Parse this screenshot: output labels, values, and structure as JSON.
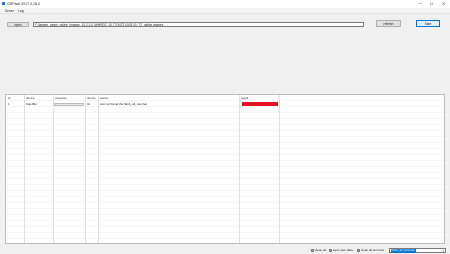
{
  "window": {
    "title": "GSPack 2017.4.28.0",
    "minimize_glyph": "—",
    "maximize_glyph": "☐",
    "close_glyph": "✕"
  },
  "menu": {
    "items": [
      "Driver",
      "Log"
    ]
  },
  "toolbar": {
    "open_label": "open",
    "path_value": "F:\\fastem_gesm_gslive_images_10.2.2.0 \\WHRD2_20 77\\3472 0003 00_T2_gslive images",
    "refresh_label": "refresh",
    "start_label": "Start"
  },
  "table": {
    "columns": [
      "id",
      "device",
      "progress",
      "device",
      "status",
      "result"
    ],
    "rows": [
      {
        "id": "1",
        "device": "Kap-Blu",
        "progress": 0,
        "device2": "3x",
        "status": "can not found the flash_all_root.bat",
        "result": ""
      }
    ]
  },
  "footer": {
    "options": [
      {
        "label": "clean all",
        "selected": false
      },
      {
        "label": "save user data",
        "selected": false
      },
      {
        "label": "clean all and lock",
        "selected": true
      }
    ],
    "dropdown_value": "flash_all_lock.bat"
  },
  "colors": {
    "accent": "#0078d7",
    "error": "#e81123",
    "progress": "#06b025"
  }
}
